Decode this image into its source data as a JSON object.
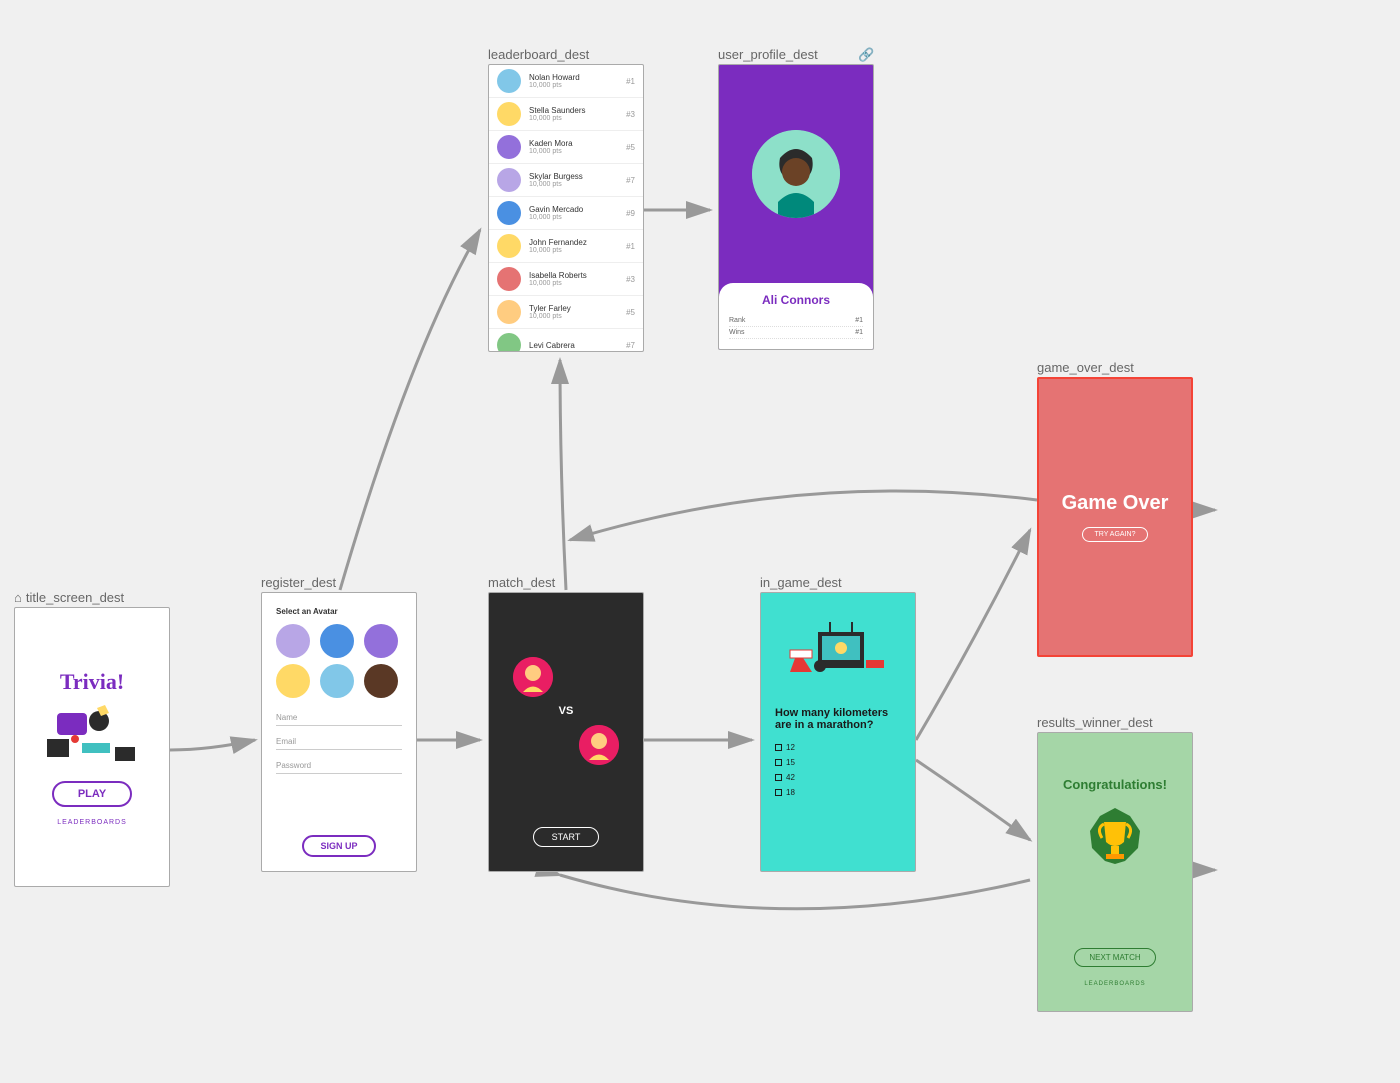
{
  "nodes": {
    "title_screen": {
      "label": "title_screen_dest",
      "title": "Trivia!",
      "play": "PLAY",
      "leaderboards": "LEADERBOARDS"
    },
    "register": {
      "label": "register_dest",
      "header": "Select an Avatar",
      "name_ph": "Name",
      "email_ph": "Email",
      "password_ph": "Password",
      "signup": "SIGN UP"
    },
    "leaderboard": {
      "label": "leaderboard_dest",
      "rows": [
        {
          "name": "Nolan Howard",
          "pts": "10,000 pts",
          "rank": "#1"
        },
        {
          "name": "Stella Saunders",
          "pts": "10,000 pts",
          "rank": "#3"
        },
        {
          "name": "Kaden Mora",
          "pts": "10,000 pts",
          "rank": "#5"
        },
        {
          "name": "Skylar Burgess",
          "pts": "10,000 pts",
          "rank": "#7"
        },
        {
          "name": "Gavin Mercado",
          "pts": "10,000 pts",
          "rank": "#9"
        },
        {
          "name": "John Fernandez",
          "pts": "10,000 pts",
          "rank": "#1"
        },
        {
          "name": "Isabella Roberts",
          "pts": "10,000 pts",
          "rank": "#3"
        },
        {
          "name": "Tyler Farley",
          "pts": "10,000 pts",
          "rank": "#5"
        },
        {
          "name": "Levi Cabrera",
          "pts": "",
          "rank": "#7"
        }
      ]
    },
    "user_profile": {
      "label": "user_profile_dest",
      "name": "Ali Connors",
      "rank_label": "Rank",
      "rank_val": "#1",
      "wins_label": "Wins",
      "wins_val": "#1"
    },
    "match": {
      "label": "match_dest",
      "vs": "VS",
      "start": "START"
    },
    "in_game": {
      "label": "in_game_dest",
      "question": "How many kilometers are in a marathon?",
      "opts": [
        "12",
        "15",
        "42",
        "18"
      ]
    },
    "game_over": {
      "label": "game_over_dest",
      "title": "Game Over",
      "try_again": "TRY AGAIN?"
    },
    "results_winner": {
      "label": "results_winner_dest",
      "title": "Congratulations!",
      "next": "NEXT MATCH",
      "leaderboards": "LEADERBOARDS"
    }
  },
  "avatar_colors": [
    "#b8a6e6",
    "#4a90e2",
    "#9370db",
    "#ffd966",
    "#81c7e8",
    "#5a3825"
  ]
}
